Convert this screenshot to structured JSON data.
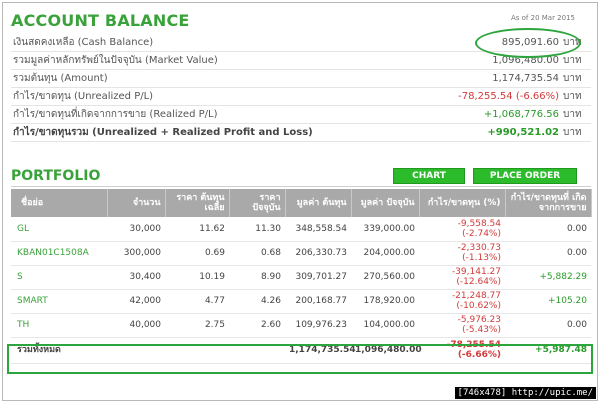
{
  "header": {
    "title": "ACCOUNT BALANCE",
    "as_of": "As of 20 Mar 2015"
  },
  "balance": {
    "unit": "บาท",
    "rows": [
      {
        "label": "เงินสดคงเหลือ (Cash Balance)",
        "value": "895,091.60",
        "unit": "บาท",
        "tone": ""
      },
      {
        "label": "รวมมูลค่าหลักทรัพย์ในปัจจุบัน (Market Value)",
        "value": "1,096,480.00",
        "unit": "บาท",
        "tone": ""
      },
      {
        "label": "รวมต้นทุน (Amount)",
        "value": "1,174,735.54",
        "unit": "บาท",
        "tone": ""
      },
      {
        "label": "กำไร/ขาดทุน (Unrealized P/L)",
        "value": "-78,255.54 (-6.66%)",
        "unit": "บาท",
        "tone": "red"
      },
      {
        "label": "กำไร/ขาดทุนที่เกิดจากการขาย (Realized P/L)",
        "value": "+1,068,776.56",
        "unit": "บาท",
        "tone": "green"
      },
      {
        "label": "กำไร/ขาดทุนรวม (Unrealized + Realized Profit and Loss)",
        "value": "+990,521.02",
        "unit": "บาท",
        "tone": "green"
      }
    ]
  },
  "portfolio": {
    "title": "PORTFOLIO",
    "chart_button": "CHART",
    "order_button": "PLACE ORDER",
    "columns": [
      "ชื่อย่อ",
      "จำนวน",
      "ราคา ต้นทุนเฉลี่ย",
      "ราคา ปัจจุบัน",
      "มูลค่า ต้นทุน",
      "มูลค่า ปัจจุบัน",
      "กำไร/ขาดทุน (%)",
      "กำไร/ขาดทุนที่ เกิดจากการขาย"
    ],
    "rows": [
      {
        "symbol": "GL",
        "qty": "30,000",
        "avg_cost": "11.62",
        "price": "11.30",
        "cost_value": "348,558.54",
        "market_value": "339,000.00",
        "pl": "-9,558.54",
        "pl_pct": "(-2.74%)",
        "realized": "0.00",
        "realized_tone": ""
      },
      {
        "symbol": "KBAN01C1508A",
        "qty": "300,000",
        "avg_cost": "0.69",
        "price": "0.68",
        "cost_value": "206,330.73",
        "market_value": "204,000.00",
        "pl": "-2,330.73",
        "pl_pct": "(-1.13%)",
        "realized": "0.00",
        "realized_tone": ""
      },
      {
        "symbol": "S",
        "qty": "30,400",
        "avg_cost": "10.19",
        "price": "8.90",
        "cost_value": "309,701.27",
        "market_value": "270,560.00",
        "pl": "-39,141.27",
        "pl_pct": "(-12.64%)",
        "realized": "+5,882.29",
        "realized_tone": "green"
      },
      {
        "symbol": "SMART",
        "qty": "42,000",
        "avg_cost": "4.77",
        "price": "4.26",
        "cost_value": "200,168.77",
        "market_value": "178,920.00",
        "pl": "-21,248.77",
        "pl_pct": "(-10.62%)",
        "realized": "+105.20",
        "realized_tone": "green"
      },
      {
        "symbol": "TH",
        "qty": "40,000",
        "avg_cost": "2.75",
        "price": "2.60",
        "cost_value": "109,976.23",
        "market_value": "104,000.00",
        "pl": "-5,976.23",
        "pl_pct": "(-5.43%)",
        "realized": "0.00",
        "realized_tone": ""
      }
    ],
    "total": {
      "label": "รวมทั้งหมด",
      "cost_value": "1,174,735.54",
      "market_value": "1,096,480.00",
      "pl": "-78,255.54",
      "pl_pct": "(-6.66%)",
      "realized": "+5,987.48"
    }
  },
  "footer": "[746x478] http://upic.me/",
  "colors": {
    "accent_green": "#3aa23a",
    "button_green": "#2bbb2b",
    "negative_red": "#d23a3a",
    "header_gray": "#a9a9a9"
  }
}
